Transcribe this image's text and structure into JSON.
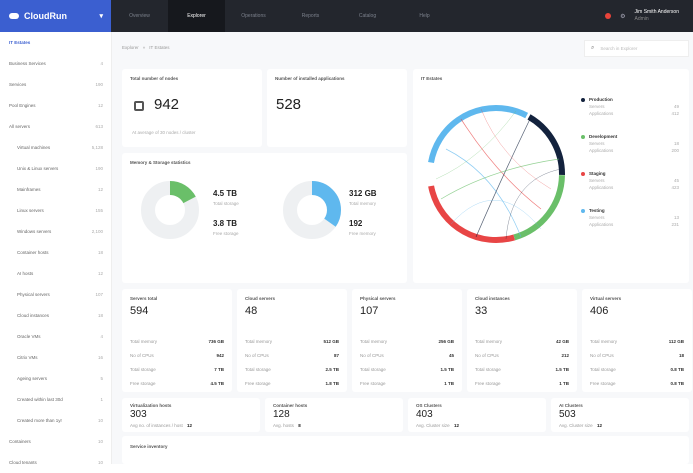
{
  "brand": {
    "name": "CloudRun",
    "chevron": "▾"
  },
  "nav": [
    "Overview",
    "Explorer",
    "Operations",
    "Reports",
    "Catalog",
    "Help"
  ],
  "nav_active": 1,
  "user": {
    "name": "Jim Smith Anderson",
    "role": "Admin"
  },
  "breadcrumb": {
    "root": "Explorer",
    "sep": "»",
    "current": "IT Estates"
  },
  "search": {
    "placeholder": "Search in Explorer"
  },
  "sidebar": [
    {
      "label": "IT Estates",
      "count": "",
      "sub": false,
      "active": true
    },
    {
      "label": "Business Services",
      "count": "4",
      "sub": false
    },
    {
      "label": "Services",
      "count": "190",
      "sub": false
    },
    {
      "label": "Pool Engines",
      "count": "12",
      "sub": false
    },
    {
      "label": "All servers",
      "count": "613",
      "sub": false
    },
    {
      "label": "Virtual machines",
      "count": "5,128",
      "sub": true
    },
    {
      "label": "Unix & Linux servers",
      "count": "190",
      "sub": true
    },
    {
      "label": "Mainframes",
      "count": "12",
      "sub": true
    },
    {
      "label": "Linux servers",
      "count": "155",
      "sub": true
    },
    {
      "label": "Windows servers",
      "count": "2,100",
      "sub": true
    },
    {
      "label": "Container hosts",
      "count": "18",
      "sub": true
    },
    {
      "label": "AI hosts",
      "count": "12",
      "sub": true
    },
    {
      "label": "Physical servers",
      "count": "107",
      "sub": true
    },
    {
      "label": "Cloud instances",
      "count": "18",
      "sub": true
    },
    {
      "label": "Oracle VMs",
      "count": "4",
      "sub": true
    },
    {
      "label": "Citrix VMs",
      "count": "16",
      "sub": true
    },
    {
      "label": "Ageing servers",
      "count": "5",
      "sub": true
    },
    {
      "label": "Created within last 30d",
      "count": "1",
      "sub": true
    },
    {
      "label": "Created more than 1yr",
      "count": "10",
      "sub": true
    },
    {
      "label": "Containers",
      "count": "10",
      "sub": false
    },
    {
      "label": "Cloud tenants",
      "count": "10",
      "sub": false
    }
  ],
  "cards": {
    "nodes": {
      "title": "Total number of nodes",
      "value": "942",
      "note": "At average of 30 nodes / cluster"
    },
    "apps": {
      "title": "Number of installed applications",
      "value": "528"
    },
    "estates": {
      "title": "IT Estates"
    },
    "memory": {
      "title": "Memory & Storage statistics",
      "storage": {
        "used": "4.5 TB",
        "used_label": "Total storage",
        "free": "3.8 TB",
        "free_label": "Free storage"
      },
      "mem": {
        "used": "312 GB",
        "used_label": "Total memory",
        "free": "192",
        "free_label": "Free memory"
      }
    }
  },
  "legend": [
    {
      "name": "Production",
      "color": "#13223d",
      "r1k": "Servers",
      "r1v": "49",
      "r2k": "Applications",
      "r2v": "412"
    },
    {
      "name": "Development",
      "color": "#6abf69",
      "r1k": "Servers",
      "r1v": "18",
      "r2k": "Applications",
      "r2v": "200"
    },
    {
      "name": "Staging",
      "color": "#e84545",
      "r1k": "Servers",
      "r1v": "45",
      "r2k": "Applications",
      "r2v": "423"
    },
    {
      "name": "Testing",
      "color": "#5fb8ee",
      "r1k": "Servers",
      "r1v": "13",
      "r2k": "Applications",
      "r2v": "231"
    }
  ],
  "server_cards": [
    {
      "title": "Servers total",
      "value": "594",
      "rows": [
        [
          "Total memory",
          "736 GB"
        ],
        [
          "No of CPUs",
          "942"
        ],
        [
          "Total storage",
          "7 TB"
        ],
        [
          "Free storage",
          "4.5 TB"
        ]
      ]
    },
    {
      "title": "Cloud servers",
      "value": "48",
      "rows": [
        [
          "Total memory",
          "512 GB"
        ],
        [
          "No of CPUs",
          "87"
        ],
        [
          "Total storage",
          "2.5 TB"
        ],
        [
          "Free storage",
          "1.8 TB"
        ]
      ]
    },
    {
      "title": "Physical servers",
      "value": "107",
      "rows": [
        [
          "Total memory",
          "256 GB"
        ],
        [
          "No of CPUs",
          "45"
        ],
        [
          "Total storage",
          "1.5 TB"
        ],
        [
          "Free storage",
          "1 TB"
        ]
      ]
    },
    {
      "title": "Cloud instances",
      "value": "33",
      "rows": [
        [
          "Total memory",
          "42 GB"
        ],
        [
          "No of CPUs",
          "212"
        ],
        [
          "Total storage",
          "1.5 TB"
        ],
        [
          "Free storage",
          "1 TB"
        ]
      ]
    },
    {
      "title": "Virtual servers",
      "value": "406",
      "rows": [
        [
          "Total memory",
          "112 GB"
        ],
        [
          "No of CPUs",
          "18"
        ],
        [
          "Total storage",
          "0.8 TB"
        ],
        [
          "Free storage",
          "0.8 TB"
        ]
      ]
    }
  ],
  "host_cards": [
    {
      "title": "Virtualization hosts",
      "value": "303",
      "k": "Avg no. of instances / host",
      "v": "12"
    },
    {
      "title": "Container hosts",
      "value": "128",
      "k": "Avg. hosts",
      "v": "8"
    },
    {
      "title": "OS Clusters",
      "value": "403",
      "k": "Avg. Cluster size",
      "v": "12"
    },
    {
      "title": "AI Clusters",
      "value": "503",
      "k": "Avg. Cluster size",
      "v": "12"
    }
  ],
  "inventory": {
    "title": "Service inventory"
  }
}
